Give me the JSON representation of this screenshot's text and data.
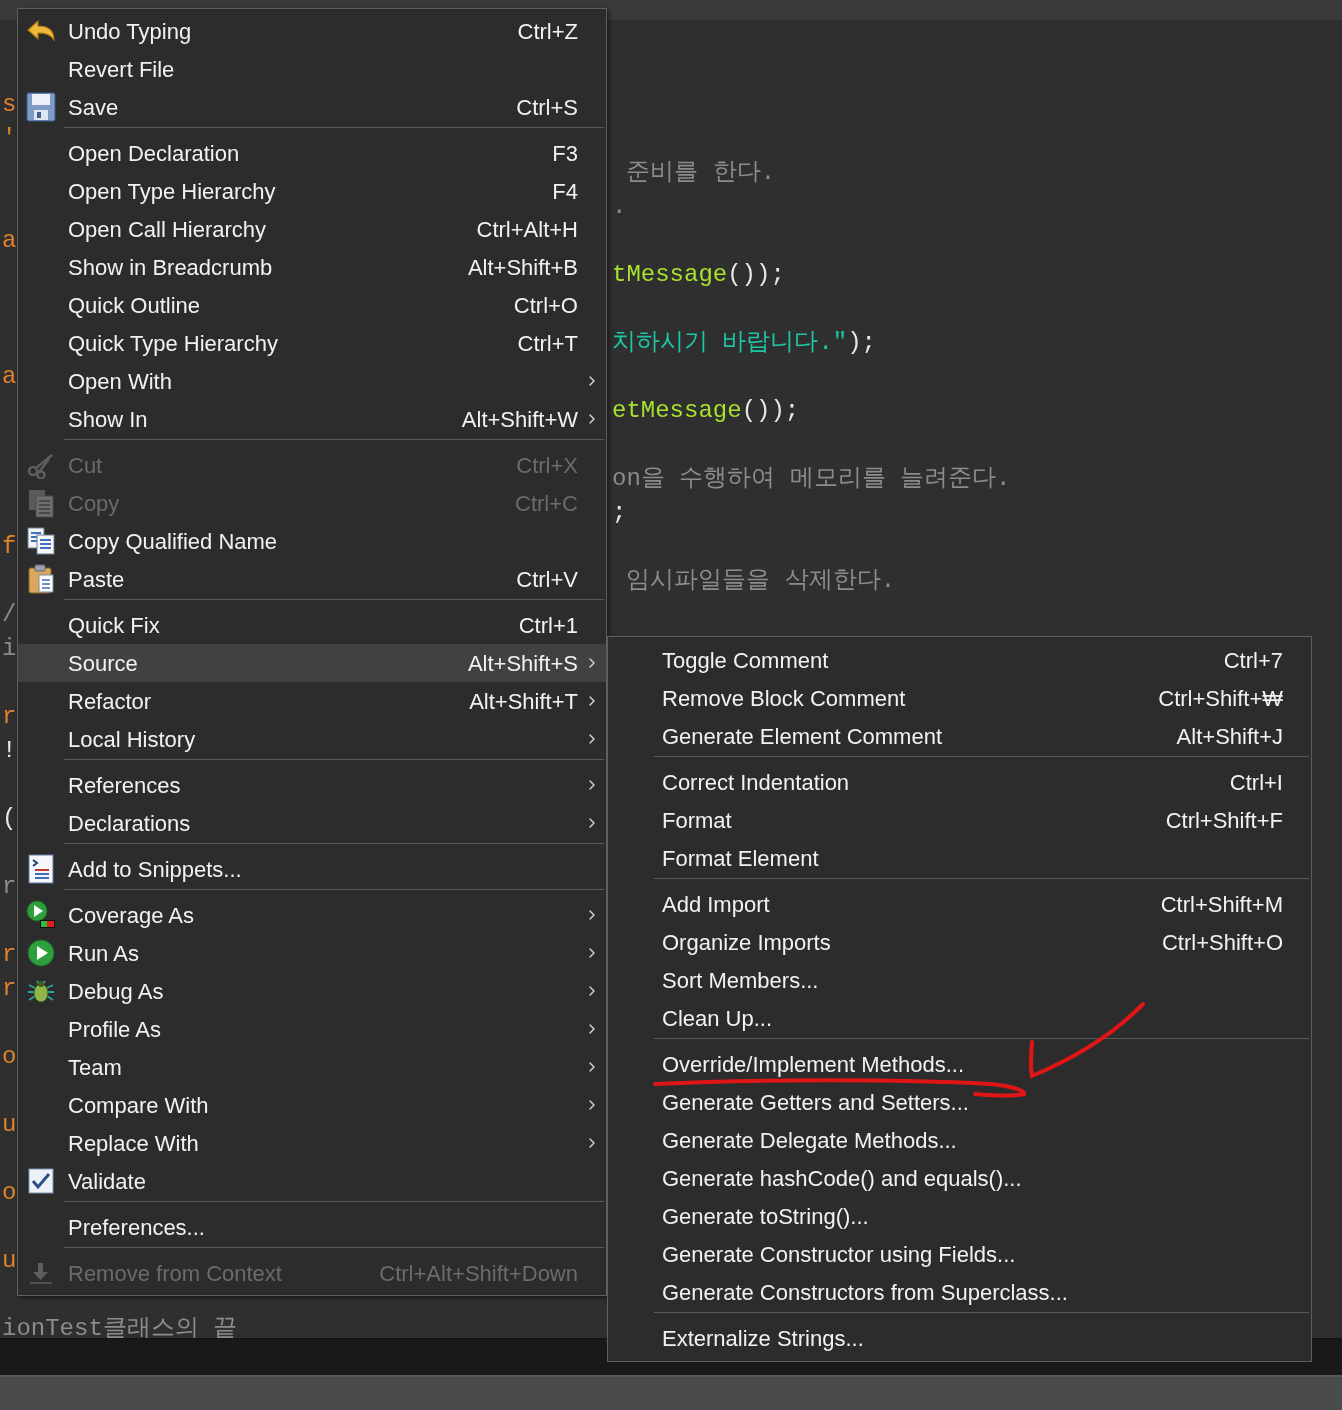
{
  "editor": {
    "lines": [
      {
        "left": [
          {
            "text": "s",
            "kind": "keyword"
          }
        ]
      },
      {
        "left": [
          {
            "text": "'",
            "kind": "keyword"
          }
        ]
      },
      {
        "right": [
          {
            "text": " 준비를 한다.",
            "kind": "comment"
          }
        ]
      },
      {
        "right": [
          {
            "text": ".",
            "kind": "comment"
          }
        ]
      },
      {
        "left": [
          {
            "text": "a",
            "kind": "keyword"
          }
        ]
      },
      {
        "right": [
          {
            "text": "tMessage",
            "kind": "method"
          },
          {
            "text": "());",
            "kind": "plain"
          }
        ]
      },
      {
        "right": [
          {
            "text": "치하시기 바랍니다.\"",
            "kind": "string"
          },
          {
            "text": ");",
            "kind": "plain"
          }
        ]
      },
      {
        "left": [
          {
            "text": "a",
            "kind": "keyword"
          }
        ]
      },
      {
        "right": [
          {
            "text": "etMessage",
            "kind": "method"
          },
          {
            "text": "());",
            "kind": "plain"
          }
        ]
      },
      {
        "right": [
          {
            "text": "on을 수행하여 메모리를 늘려준다.",
            "kind": "comment"
          }
        ]
      },
      {
        "right": [
          {
            "text": ";",
            "kind": "plain"
          }
        ]
      },
      {
        "left": [
          {
            "text": "f",
            "kind": "keyword"
          }
        ]
      },
      {
        "right": [
          {
            "text": " 임시파일들을 삭제한다.",
            "kind": "comment"
          }
        ]
      },
      {
        "left": [
          {
            "text": "/",
            "kind": "comment"
          }
        ]
      },
      {
        "left": [
          {
            "text": "i",
            "kind": "comment"
          }
        ]
      },
      {
        "left": [
          {
            "text": "r",
            "kind": "keyword"
          }
        ]
      },
      {
        "left": [
          {
            "text": "!",
            "kind": "plain"
          }
        ]
      },
      {
        "left": [
          {
            "text": "(",
            "kind": "plain"
          }
        ]
      },
      {
        "left": [
          {
            "text": "r",
            "kind": "comment"
          }
        ]
      },
      {
        "left": [
          {
            "text": "r",
            "kind": "keyword"
          }
        ]
      },
      {
        "left": [
          {
            "text": "r",
            "kind": "keyword"
          }
        ]
      },
      {
        "left": [
          {
            "text": "o",
            "kind": "keyword"
          }
        ]
      },
      {
        "left": [
          {
            "text": "u",
            "kind": "keyword"
          }
        ]
      },
      {
        "left": [
          {
            "text": "o",
            "kind": "keyword"
          }
        ]
      },
      {
        "left": [
          {
            "text": "u",
            "kind": "keyword"
          }
        ]
      },
      {
        "left": [
          {
            "text": "ionTest클래스의 끝",
            "kind": "comment"
          }
        ]
      }
    ]
  },
  "context_menu": {
    "items": [
      {
        "kind": "item",
        "label": "Undo Typing",
        "shortcut": "Ctrl+Z",
        "submenu": false,
        "disabled": false,
        "selected": false
      },
      {
        "kind": "item",
        "label": "Revert File",
        "submenu": false,
        "disabled": false,
        "selected": false
      },
      {
        "kind": "item",
        "label": "Save",
        "shortcut": "Ctrl+S",
        "submenu": false,
        "disabled": false,
        "selected": false
      },
      {
        "kind": "separator"
      },
      {
        "kind": "item",
        "label": "Open Declaration",
        "shortcut": "F3",
        "submenu": false,
        "disabled": false,
        "selected": false
      },
      {
        "kind": "item",
        "label": "Open Type Hierarchy",
        "shortcut": "F4",
        "submenu": false,
        "disabled": false,
        "selected": false
      },
      {
        "kind": "item",
        "label": "Open Call Hierarchy",
        "shortcut": "Ctrl+Alt+H",
        "submenu": false,
        "disabled": false,
        "selected": false
      },
      {
        "kind": "item",
        "label": "Show in Breadcrumb",
        "shortcut": "Alt+Shift+B",
        "submenu": false,
        "disabled": false,
        "selected": false
      },
      {
        "kind": "item",
        "label": "Quick Outline",
        "shortcut": "Ctrl+O",
        "submenu": false,
        "disabled": false,
        "selected": false
      },
      {
        "kind": "item",
        "label": "Quick Type Hierarchy",
        "shortcut": "Ctrl+T",
        "submenu": false,
        "disabled": false,
        "selected": false
      },
      {
        "kind": "item",
        "label": "Open With",
        "submenu": true,
        "disabled": false,
        "selected": false
      },
      {
        "kind": "item",
        "label": "Show In",
        "shortcut": "Alt+Shift+W",
        "submenu": true,
        "disabled": false,
        "selected": false
      },
      {
        "kind": "separator"
      },
      {
        "kind": "item",
        "label": "Cut",
        "shortcut": "Ctrl+X",
        "submenu": false,
        "disabled": true,
        "selected": false
      },
      {
        "kind": "item",
        "label": "Copy",
        "shortcut": "Ctrl+C",
        "submenu": false,
        "disabled": true,
        "selected": false
      },
      {
        "kind": "item",
        "label": "Copy Qualified Name",
        "submenu": false,
        "disabled": false,
        "selected": false
      },
      {
        "kind": "item",
        "label": "Paste",
        "shortcut": "Ctrl+V",
        "submenu": false,
        "disabled": false,
        "selected": false
      },
      {
        "kind": "separator"
      },
      {
        "kind": "item",
        "label": "Quick Fix",
        "shortcut": "Ctrl+1",
        "submenu": false,
        "disabled": false,
        "selected": false
      },
      {
        "kind": "item",
        "label": "Source",
        "shortcut": "Alt+Shift+S",
        "submenu": true,
        "disabled": false,
        "selected": true
      },
      {
        "kind": "item",
        "label": "Refactor",
        "shortcut": "Alt+Shift+T",
        "submenu": true,
        "disabled": false,
        "selected": false
      },
      {
        "kind": "item",
        "label": "Local History",
        "submenu": true,
        "disabled": false,
        "selected": false
      },
      {
        "kind": "separator"
      },
      {
        "kind": "item",
        "label": "References",
        "submenu": true,
        "disabled": false,
        "selected": false
      },
      {
        "kind": "item",
        "label": "Declarations",
        "submenu": true,
        "disabled": false,
        "selected": false
      },
      {
        "kind": "separator"
      },
      {
        "kind": "item",
        "label": "Add to Snippets...",
        "submenu": false,
        "disabled": false,
        "selected": false
      },
      {
        "kind": "separator"
      },
      {
        "kind": "item",
        "label": "Coverage As",
        "submenu": true,
        "disabled": false,
        "selected": false
      },
      {
        "kind": "item",
        "label": "Run As",
        "submenu": true,
        "disabled": false,
        "selected": false
      },
      {
        "kind": "item",
        "label": "Debug As",
        "submenu": true,
        "disabled": false,
        "selected": false
      },
      {
        "kind": "item",
        "label": "Profile As",
        "submenu": true,
        "disabled": false,
        "selected": false
      },
      {
        "kind": "item",
        "label": "Team",
        "submenu": true,
        "disabled": false,
        "selected": false
      },
      {
        "kind": "item",
        "label": "Compare With",
        "submenu": true,
        "disabled": false,
        "selected": false
      },
      {
        "kind": "item",
        "label": "Replace With",
        "submenu": true,
        "disabled": false,
        "selected": false
      },
      {
        "kind": "item",
        "label": "Validate",
        "submenu": false,
        "disabled": false,
        "selected": false
      },
      {
        "kind": "separator"
      },
      {
        "kind": "item",
        "label": "Preferences...",
        "submenu": false,
        "disabled": false,
        "selected": false
      },
      {
        "kind": "separator"
      },
      {
        "kind": "item",
        "label": "Remove from Context",
        "shortcut": "Ctrl+Alt+Shift+Down",
        "submenu": false,
        "disabled": true,
        "selected": false
      }
    ]
  },
  "source_submenu": {
    "items": [
      {
        "kind": "item",
        "label": "Toggle Comment",
        "shortcut": "Ctrl+7",
        "selected": false
      },
      {
        "kind": "item",
        "label": "Remove Block Comment",
        "shortcut": "Ctrl+Shift+₩",
        "selected": false
      },
      {
        "kind": "item",
        "label": "Generate Element Comment",
        "shortcut": "Alt+Shift+J",
        "selected": false
      },
      {
        "kind": "separator"
      },
      {
        "kind": "item",
        "label": "Correct Indentation",
        "shortcut": "Ctrl+I",
        "selected": false
      },
      {
        "kind": "item",
        "label": "Format",
        "shortcut": "Ctrl+Shift+F",
        "selected": false
      },
      {
        "kind": "item",
        "label": "Format Element",
        "selected": false
      },
      {
        "kind": "separator"
      },
      {
        "kind": "item",
        "label": "Add Import",
        "shortcut": "Ctrl+Shift+M",
        "selected": false
      },
      {
        "kind": "item",
        "label": "Organize Imports",
        "shortcut": "Ctrl+Shift+O",
        "selected": false
      },
      {
        "kind": "item",
        "label": "Sort Members...",
        "selected": false
      },
      {
        "kind": "item",
        "label": "Clean Up...",
        "selected": false
      },
      {
        "kind": "separator"
      },
      {
        "kind": "item",
        "label": "Override/Implement Methods...",
        "selected": false
      },
      {
        "kind": "item",
        "label": "Generate Getters and Setters...",
        "selected": false
      },
      {
        "kind": "item",
        "label": "Generate Delegate Methods...",
        "selected": false
      },
      {
        "kind": "item",
        "label": "Generate hashCode() and equals()...",
        "selected": false
      },
      {
        "kind": "item",
        "label": "Generate toString()...",
        "selected": false
      },
      {
        "kind": "item",
        "label": "Generate Constructor using Fields...",
        "selected": false
      },
      {
        "kind": "item",
        "label": "Generate Constructors from Superclass...",
        "selected": false
      },
      {
        "kind": "separator"
      },
      {
        "kind": "item",
        "label": "Externalize Strings...",
        "selected": false
      }
    ]
  }
}
